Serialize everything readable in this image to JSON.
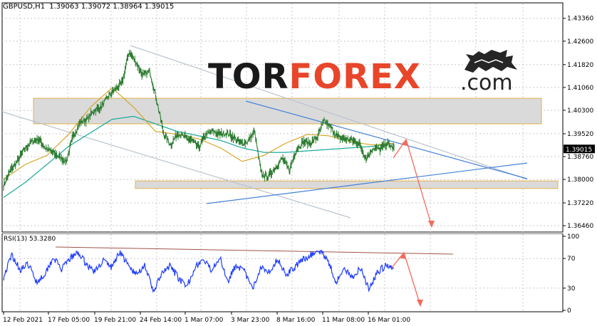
{
  "chart_data": [
    {
      "type": "line",
      "instrument": "GBPUSD,H1",
      "header_values": [
        "1.39063",
        "1.39072",
        "1.38964",
        "1.39015"
      ],
      "current_price_label": "1.39015",
      "current_price": 1.39015,
      "y_ticks": [
        "1.43360",
        "1.42600",
        "1.41820",
        "1.41060",
        "1.40300",
        "1.39520",
        "1.38760",
        "1.38000",
        "1.37220",
        "1.36460"
      ],
      "ylim": [
        1.3625,
        1.4378
      ],
      "x_tick_labels": [
        "12 Feb 2021",
        "17 Feb 05:00",
        "19 Feb 21:00",
        "24 Feb 14:00",
        "1 Mar 07:00",
        "3 Mar 23:00",
        "8 Mar 16:00",
        "11 Mar 08:00",
        "16 Mar 01:00"
      ],
      "price_anchors": [
        1.378,
        1.383,
        1.386,
        1.39,
        1.3925,
        1.3935,
        1.3905,
        1.389,
        1.3875,
        1.386,
        1.3945,
        1.399,
        1.4,
        1.403,
        1.404,
        1.4075,
        1.41,
        1.412,
        1.4225,
        1.419,
        1.4145,
        1.416,
        1.406,
        1.395,
        1.3915,
        1.3955,
        1.394,
        1.393,
        1.3905,
        1.395,
        1.396,
        1.395,
        1.3955,
        1.394,
        1.392,
        1.3925,
        1.396,
        1.3815,
        1.381,
        1.384,
        1.387,
        1.383,
        1.39,
        1.3925,
        1.392,
        1.394,
        1.3995,
        1.397,
        1.394,
        1.3935,
        1.393,
        1.392,
        1.387,
        1.3905,
        1.39,
        1.392,
        1.3903
      ],
      "ma_slow_anchors": [
        1.374,
        1.379,
        1.385,
        1.391,
        1.3955,
        1.4,
        1.401,
        1.3985,
        1.396,
        1.3945,
        1.393,
        1.3905,
        1.389,
        1.389,
        1.3895,
        1.39,
        1.3905,
        1.391,
        1.392
      ],
      "ma_fast_anchors": [
        1.38,
        1.385,
        1.388,
        1.395,
        1.404,
        1.4105,
        1.404,
        1.396,
        1.395,
        1.3935,
        1.3905,
        1.386,
        1.388,
        1.392,
        1.395,
        1.3945,
        1.3925,
        1.3915,
        1.392
      ],
      "support_zone": [
        1.377,
        1.3795
      ],
      "resistance_zone": [
        1.3985,
        1.407
      ]
    },
    {
      "type": "line",
      "label": "RSI(13) 53.3280",
      "y_ticks": [
        "100",
        "70",
        "30",
        "0"
      ],
      "ylim": [
        0,
        100
      ],
      "rsi_anchors": [
        45,
        75,
        55,
        62,
        38,
        50,
        72,
        55,
        70,
        78,
        62,
        52,
        68,
        58,
        80,
        60,
        48,
        62,
        25,
        48,
        60,
        45,
        30,
        58,
        68,
        55,
        72,
        40,
        62,
        52,
        28,
        60,
        52,
        70,
        48,
        58,
        68,
        75,
        80,
        70,
        38,
        55,
        45,
        58,
        28,
        52,
        60,
        56
      ]
    }
  ],
  "branding": {
    "part1": "TOR",
    "part2": "FOREX",
    "suffix": ".com",
    "colors": {
      "tor": "#1a1a1a",
      "forex": "#e8462a",
      "com": "#222222",
      "bull": "#262626"
    }
  },
  "colors": {
    "price": "#2e7d32",
    "ma_fast": "#d4a017",
    "ma_slow": "#17a79a",
    "channel": "#b9c4cf",
    "triangle": "#4682d6",
    "projection": "#f26b5b",
    "rsi": "#1e3cff",
    "rsi_trend": "#a0524a",
    "zone_fill": "#dadada",
    "zone_border": "#e3b04b",
    "price_label_bg": "#000000"
  }
}
